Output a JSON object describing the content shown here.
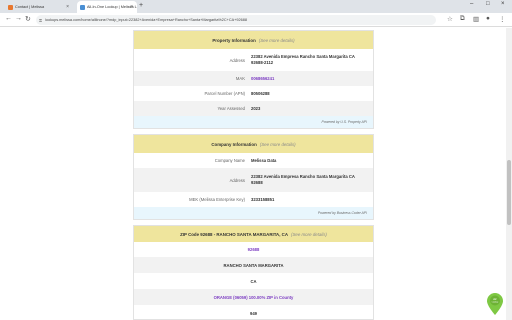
{
  "browser": {
    "tabs": [
      {
        "title": "Contact | Melissa",
        "active": false,
        "favicon_color": "#e8772e"
      },
      {
        "title": "All-In-One Lookup | Melissa L",
        "active": true,
        "favicon_color": "#4a8fd4"
      }
    ],
    "url": "lookups.melissa.com/home/alllinone/?mdp_input=22382+Avenida+Empresa+Rancho+Santa+Margarita%2C+CA+92688"
  },
  "property": {
    "header": "Property Information",
    "more": "(See more details)",
    "rows": [
      {
        "label": "Address",
        "value": "22382 Avenida Empresa Rancho Santa Margarita CA 92688-2112",
        "link": false
      },
      {
        "label": "MAK",
        "value": "0068656241",
        "link": true
      },
      {
        "label": "Parcel Number (APN)",
        "value": "80506288",
        "link": false
      },
      {
        "label": "Year Assessed",
        "value": "2023",
        "link": false
      }
    ],
    "powered": "Powered by U.S. Property API"
  },
  "company": {
    "header": "Company Information",
    "more": "(See more details)",
    "rows": [
      {
        "label": "Company Name",
        "value": "Melissa Data",
        "link": false
      },
      {
        "label": "Address",
        "value": "22382 Avenida Empresa Rancho Santa Margarita CA 92688",
        "link": false
      },
      {
        "label": "MEK (Melissa Enterprise Key)",
        "value": "3233158851",
        "link": false
      }
    ],
    "powered": "Powered by Business Coder API"
  },
  "zip": {
    "header": "ZIP Code 92688 - RANCHO SANTA MARGARITA, CA",
    "more": "(See more details)",
    "rows": [
      {
        "value": "92688",
        "link": true
      },
      {
        "value": "RANCHO SANTA MARGARITA",
        "link": false
      },
      {
        "value": "CA",
        "link": false
      },
      {
        "value": "ORANGE (06059) 100.00% ZIP in County",
        "link": true
      },
      {
        "value": "949",
        "link": false
      }
    ]
  },
  "chat_pin": {
    "label": "ZIP Lookup",
    "color": "#7ec843"
  }
}
